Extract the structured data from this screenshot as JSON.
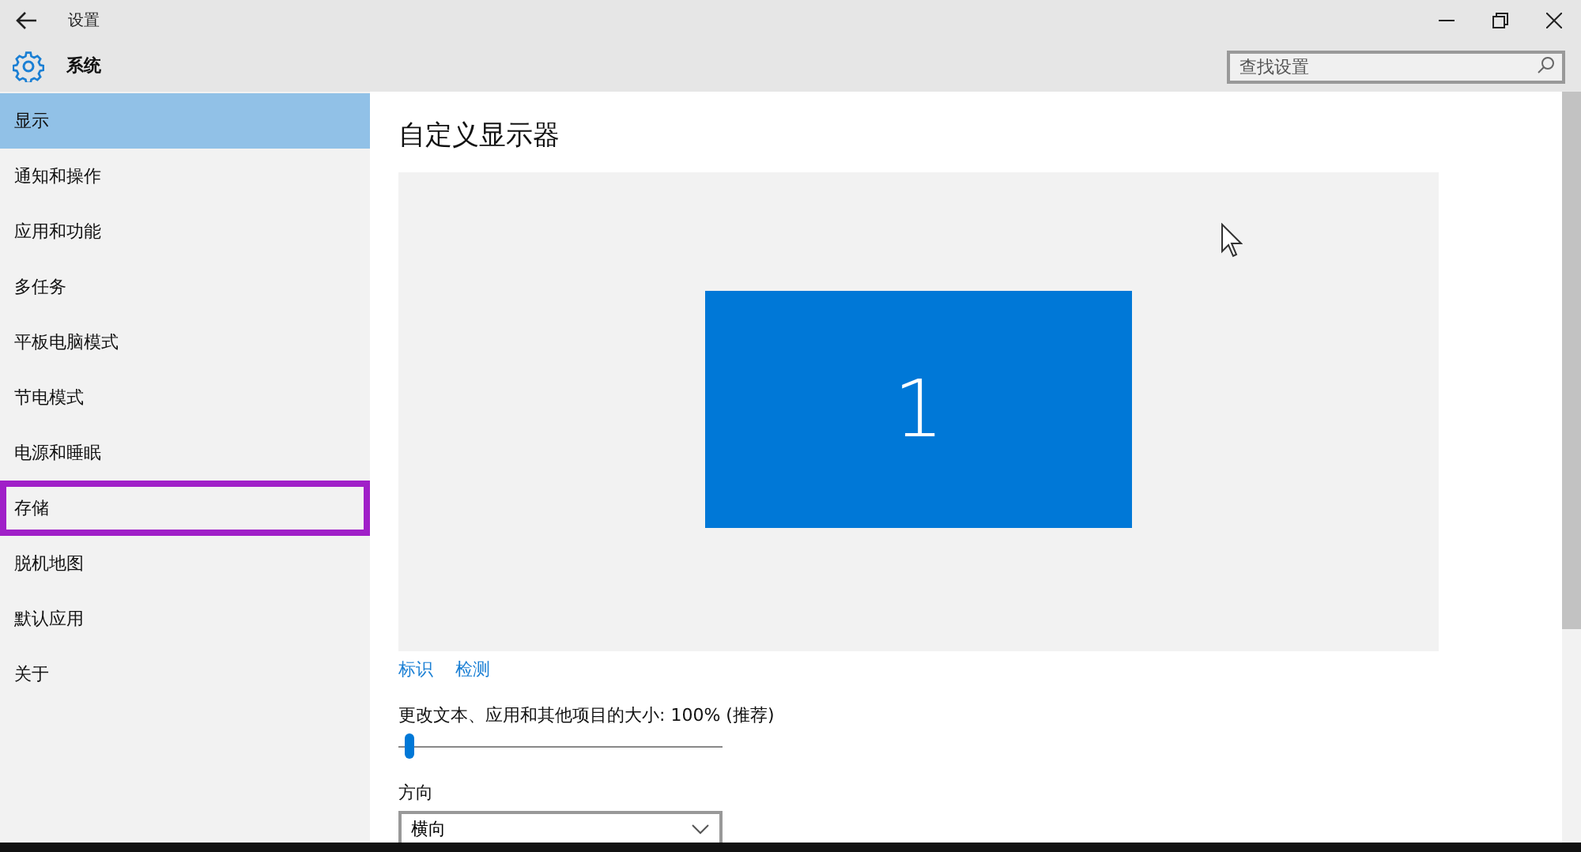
{
  "window": {
    "title": "设置"
  },
  "header": {
    "title": "系统",
    "search": {
      "placeholder": "查找设置"
    }
  },
  "sidebar": {
    "items": [
      {
        "label": "显示",
        "selected": true,
        "outlined": false
      },
      {
        "label": "通知和操作",
        "selected": false,
        "outlined": false
      },
      {
        "label": "应用和功能",
        "selected": false,
        "outlined": false
      },
      {
        "label": "多任务",
        "selected": false,
        "outlined": false
      },
      {
        "label": "平板电脑模式",
        "selected": false,
        "outlined": false
      },
      {
        "label": "节电模式",
        "selected": false,
        "outlined": false
      },
      {
        "label": "电源和睡眠",
        "selected": false,
        "outlined": false
      },
      {
        "label": "存储",
        "selected": false,
        "outlined": true
      },
      {
        "label": "脱机地图",
        "selected": false,
        "outlined": false
      },
      {
        "label": "默认应用",
        "selected": false,
        "outlined": false
      },
      {
        "label": "关于",
        "selected": false,
        "outlined": false
      }
    ]
  },
  "content": {
    "title": "自定义显示器",
    "monitor": "1",
    "links": [
      "标识",
      "检测"
    ],
    "scale": {
      "label": "更改文本、应用和其他项目的大小: 100% (推荐)",
      "level": 0.02
    },
    "orientation": {
      "label": "方向",
      "value": "横向"
    }
  }
}
